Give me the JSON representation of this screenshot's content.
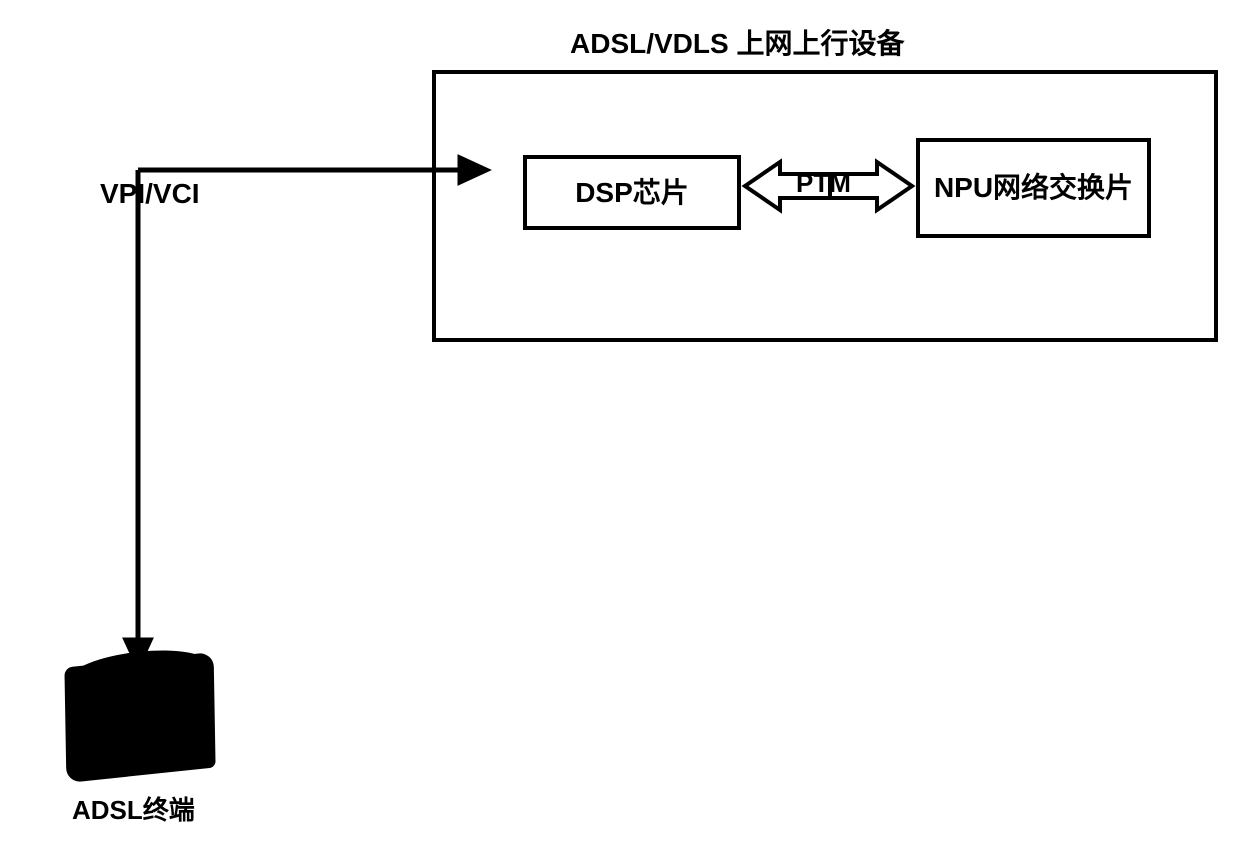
{
  "title": "ADSL/VDLS 上网上行设备",
  "link_label": "VPI/VCI",
  "dsp_box": "DSP芯片",
  "bus_label": "PTM",
  "npu_box": "NPU网络交换片",
  "terminal_label": "ADSL终端"
}
